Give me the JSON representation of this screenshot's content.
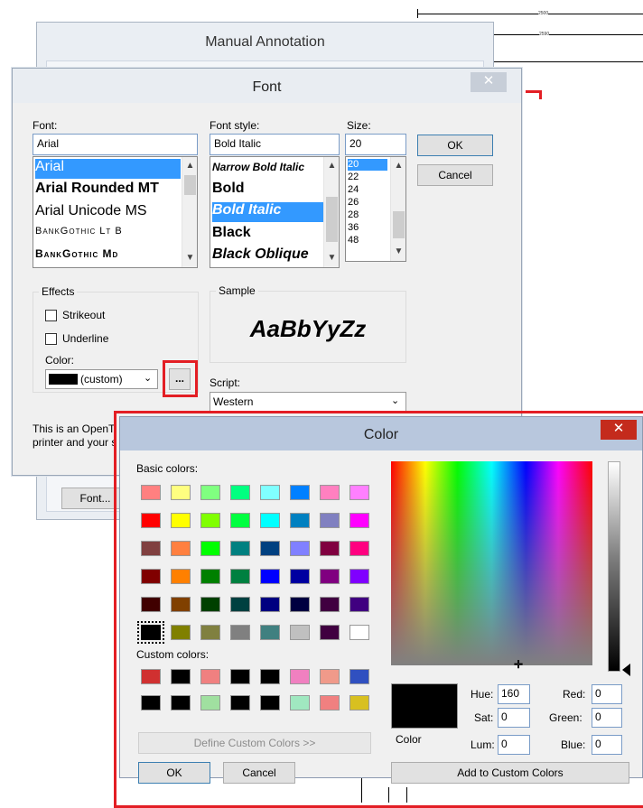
{
  "background": {
    "dim_top_label": "2500",
    "dim_second_label": "2590"
  },
  "manual_annotation": {
    "title": "Manual Annotation",
    "font_button": "Font..."
  },
  "font_dialog": {
    "title": "Font",
    "close_glyph": "✕",
    "font_label": "Font:",
    "font_value": "Arial",
    "font_list": [
      "Arial",
      "Arial Rounded MT",
      "Arial Unicode MS",
      "BankGothic Lt B",
      "BankGothic Md"
    ],
    "style_label": "Font style:",
    "style_value": "Bold Italic",
    "style_list": [
      "Narrow Bold Italic",
      "Bold",
      "Bold Italic",
      "Black",
      "Black Oblique"
    ],
    "size_label": "Size:",
    "size_value": "20",
    "size_list": [
      "20",
      "22",
      "24",
      "26",
      "28",
      "36",
      "48"
    ],
    "ok": "OK",
    "cancel": "Cancel",
    "effects_label": "Effects",
    "strikeout": "Strikeout",
    "underline": "Underline",
    "color_label": "Color:",
    "color_value": "(custom)",
    "more_colors": "...",
    "sample_label": "Sample",
    "sample_text": "AaBbYyZz",
    "script_label": "Script:",
    "script_value": "Western",
    "note_line1": "This is an OpenT",
    "note_line2": "printer and your s"
  },
  "color_dialog": {
    "title": "Color",
    "close_glyph": "✕",
    "basic_label": "Basic colors:",
    "basic_colors": [
      "#ff8080",
      "#ffff80",
      "#80ff80",
      "#00ff80",
      "#80ffff",
      "#0080ff",
      "#ff80c0",
      "#ff80ff",
      "#ff0000",
      "#ffff00",
      "#80ff00",
      "#00ff40",
      "#00ffff",
      "#0080c0",
      "#8080c0",
      "#ff00ff",
      "#804040",
      "#ff8040",
      "#00ff00",
      "#008080",
      "#004080",
      "#8080ff",
      "#800040",
      "#ff0080",
      "#800000",
      "#ff8000",
      "#008000",
      "#008040",
      "#0000ff",
      "#0000a0",
      "#800080",
      "#8000ff",
      "#400000",
      "#804000",
      "#004000",
      "#004040",
      "#000080",
      "#000040",
      "#400040",
      "#400080",
      "#000000",
      "#808000",
      "#808040",
      "#808080",
      "#408080",
      "#c0c0c0",
      "#400040",
      "#ffffff"
    ],
    "custom_label": "Custom colors:",
    "custom_colors": [
      "#d03030",
      "#000000",
      "#f08080",
      "#000000",
      "#000000",
      "#f080c0",
      "#f09a8a",
      "#3050c0",
      "#000000",
      "#000000",
      "#a0e0a0",
      "#000000",
      "#000000",
      "#a0e8c0",
      "#f08080",
      "#d8c020"
    ],
    "define_custom": "Define Custom Colors >>",
    "ok": "OK",
    "cancel": "Cancel",
    "color_solid_label": "Color",
    "hue_label": "Hue:",
    "hue_value": "160",
    "sat_label": "Sat:",
    "sat_value": "0",
    "lum_label": "Lum:",
    "lum_value": "0",
    "red_label": "Red:",
    "red_value": "0",
    "green_label": "Green:",
    "green_value": "0",
    "blue_label": "Blue:",
    "blue_value": "0",
    "add_custom": "Add to Custom Colors",
    "current_color": "#000000"
  }
}
